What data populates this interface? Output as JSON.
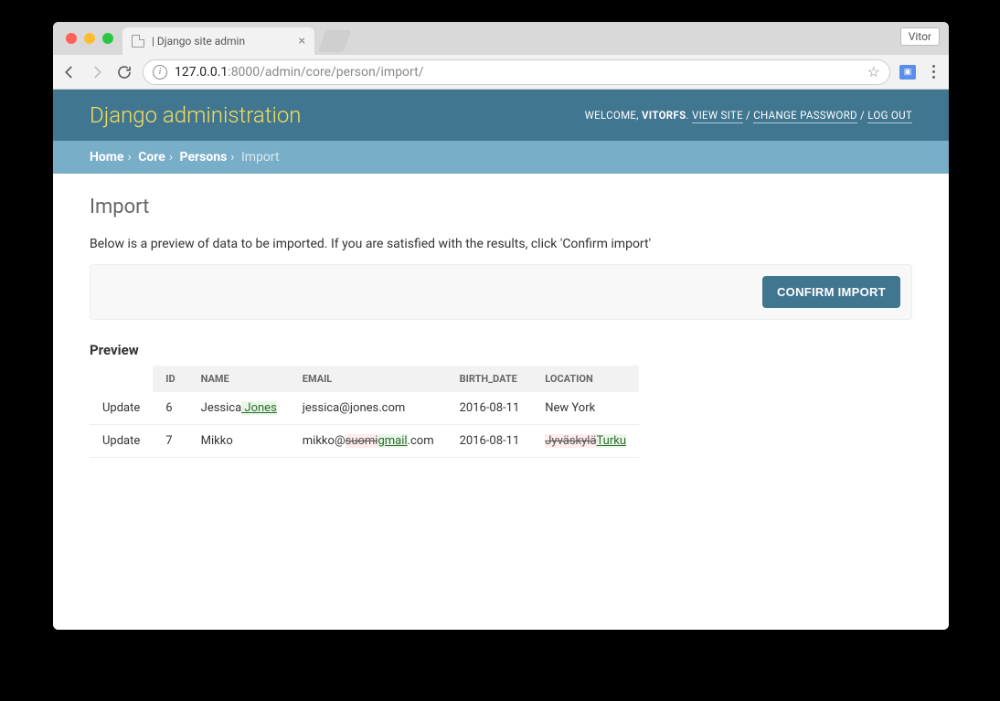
{
  "browser": {
    "tab_title": " | Django site admin",
    "profile_name": "Vitor",
    "url_host": "127.0.0.1",
    "url_port_path": ":8000/admin/core/person/import/"
  },
  "header": {
    "site_title": "Django administration",
    "welcome_prefix": "WELCOME, ",
    "username": "VITORFS",
    "view_site": "VIEW SITE",
    "change_password": "CHANGE PASSWORD",
    "log_out": "LOG OUT"
  },
  "breadcrumbs": {
    "home": "Home",
    "app": "Core",
    "model": "Persons",
    "current": "Import"
  },
  "content": {
    "page_title": "Import",
    "helptext": "Below is a preview of data to be imported. If you are satisfied with the results, click 'Confirm import'",
    "confirm_button": "Confirm import",
    "preview_heading": "Preview"
  },
  "table": {
    "headers": {
      "action": "",
      "id": "ID",
      "name": "NAME",
      "email": "EMAIL",
      "birth_date": "BIRTH_DATE",
      "location": "LOCATION"
    },
    "rows": [
      {
        "action": "Update",
        "id": "6",
        "name_pre": "Jessica",
        "name_ins": " Jones",
        "email_pre": "jessica@jones.com",
        "birth_date": "2016-08-11",
        "location_pre": "New York"
      },
      {
        "action": "Update",
        "id": "7",
        "name_pre": "Mikko",
        "email_pre": "mikko@",
        "email_del": "suomi",
        "email_ins": "gmail",
        "email_post": ".com",
        "birth_date": "2016-08-11",
        "location_del": "Jyväskylä",
        "location_ins": "Turku"
      }
    ]
  }
}
